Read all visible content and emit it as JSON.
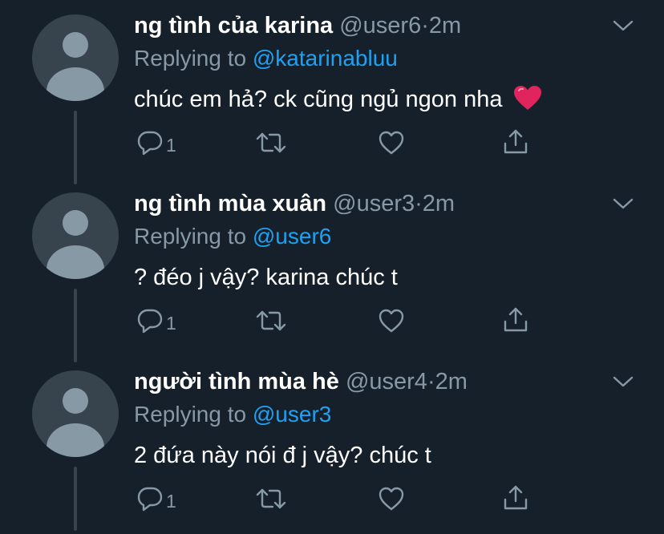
{
  "replies": [
    {
      "display_name": "ng tình của karina",
      "handle": "@user6",
      "dot": "·",
      "time": "2m",
      "replying_prefix": "Replying to ",
      "replying_to": "@katarinabluu",
      "text": "chúc em hả? ck cũng ngủ ngon nha",
      "has_heart_emoji": true,
      "reply_count": "1"
    },
    {
      "display_name": "ng tình mùa xuân",
      "handle": "@user3",
      "dot": "·",
      "time": "2m",
      "replying_prefix": "Replying to ",
      "replying_to": "@user6",
      "text": "? đéo j vậy? karina chúc t",
      "has_heart_emoji": false,
      "reply_count": "1"
    },
    {
      "display_name": "người tình mùa hè",
      "handle": "@user4",
      "dot": "·",
      "time": "2m",
      "replying_prefix": "Replying to ",
      "replying_to": "@user3",
      "text": "2 đứa này nói đ j vậy? chúc t",
      "has_heart_emoji": false,
      "reply_count": "1"
    }
  ],
  "colors": {
    "background": "#15202b",
    "secondary_text": "#8899a6",
    "accent": "#1da1f2",
    "emoji_heart": "#e0245e"
  },
  "icons": [
    "chevron-down-icon",
    "reply-icon",
    "retweet-icon",
    "like-icon",
    "share-icon",
    "red-heart-emoji"
  ]
}
